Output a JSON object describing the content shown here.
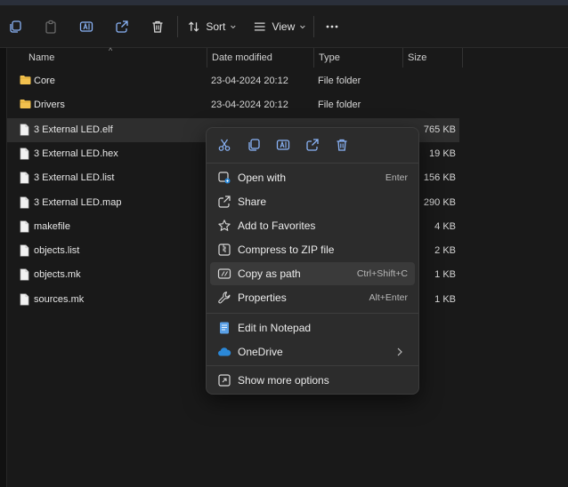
{
  "toolbar": {
    "sort_label": "Sort",
    "view_label": "View"
  },
  "columns": {
    "name": "Name",
    "date": "Date modified",
    "type": "Type",
    "size": "Size"
  },
  "files": [
    {
      "name": "Core",
      "date": "23-04-2024 20:12",
      "type": "File folder",
      "size": "",
      "kind": "folder"
    },
    {
      "name": "Drivers",
      "date": "23-04-2024 20:12",
      "type": "File folder",
      "size": "",
      "kind": "folder"
    },
    {
      "name": "3 External LED.elf",
      "date": "",
      "type": "",
      "size": "765 KB",
      "kind": "file",
      "selected": true
    },
    {
      "name": "3 External LED.hex",
      "date": "",
      "type": "",
      "size": "19 KB",
      "kind": "file"
    },
    {
      "name": "3 External LED.list",
      "date": "",
      "type": "",
      "size": "156 KB",
      "kind": "file"
    },
    {
      "name": "3 External LED.map",
      "date": "",
      "type": "",
      "size": "290 KB",
      "kind": "file"
    },
    {
      "name": "makefile",
      "date": "",
      "type": "",
      "size": "4 KB",
      "kind": "file"
    },
    {
      "name": "objects.list",
      "date": "",
      "type": "",
      "size": "2 KB",
      "kind": "file"
    },
    {
      "name": "objects.mk",
      "date": "",
      "type": "",
      "size": "1 KB",
      "kind": "file"
    },
    {
      "name": "sources.mk",
      "date": "",
      "type": "",
      "size": "1 KB",
      "kind": "file"
    }
  ],
  "context_menu": {
    "items": [
      {
        "label": "Open with",
        "shortcut": "Enter",
        "icon": "open-with-icon"
      },
      {
        "label": "Share",
        "shortcut": "",
        "icon": "share-icon"
      },
      {
        "label": "Add to Favorites",
        "shortcut": "",
        "icon": "star-icon"
      },
      {
        "label": "Compress to ZIP file",
        "shortcut": "",
        "icon": "zip-icon"
      },
      {
        "label": "Copy as path",
        "shortcut": "Ctrl+Shift+C",
        "icon": "copy-path-icon"
      },
      {
        "label": "Properties",
        "shortcut": "Alt+Enter",
        "icon": "wrench-icon"
      },
      {
        "label": "Edit in Notepad",
        "shortcut": "",
        "icon": "notepad-icon"
      },
      {
        "label": "OneDrive",
        "shortcut": "",
        "icon": "cloud-icon"
      },
      {
        "label": "Show more options",
        "shortcut": "",
        "icon": "more-options-icon"
      }
    ]
  },
  "colors": {
    "background": "#191919",
    "menu_background": "#2c2c2c",
    "folder_yellow": "#f2c14e",
    "notepad_blue": "#5aa0e6",
    "onedrive_blue": "#2b88d8",
    "icon_blue": "#8ab4f8"
  }
}
